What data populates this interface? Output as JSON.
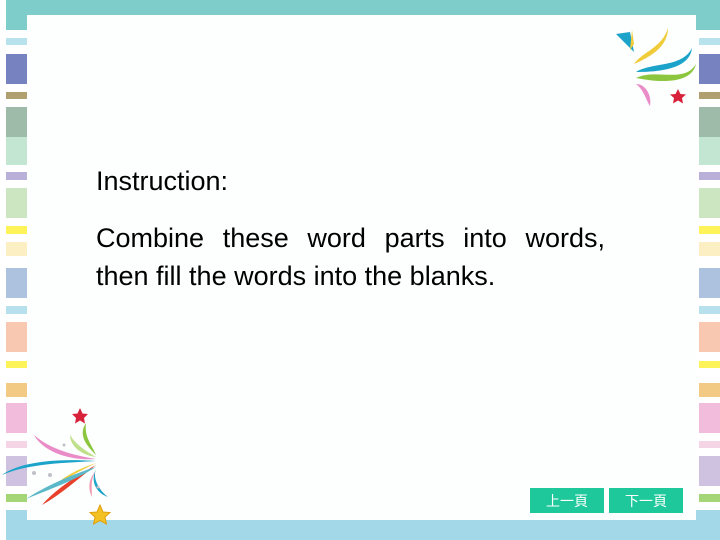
{
  "slide": {
    "instruction_title": "Instruction:",
    "instruction_body": "Combine these word parts into words, then fill the words into the blanks."
  },
  "navigation": {
    "prev_label": "上一頁",
    "next_label": "下一頁",
    "button_color": "#1ec89a"
  },
  "theme": {
    "top_bar_color": "#7ecdcb",
    "bottom_bar_color": "#a3d8e8",
    "stripe_colors": [
      "#b9e3ec",
      "#7783c0",
      "#b0a070",
      "#9dbba8",
      "#c2e6d2",
      "#b8b0d8",
      "#cbe6c0",
      "#fff35a",
      "#fbefc3",
      "#adc2de",
      "#b6e0ec",
      "#f8c8b0",
      "#fff35a",
      "#f2ca84",
      "#f2bcdc",
      "#f5d4e6",
      "#cfc2e0",
      "#a4d678"
    ]
  },
  "decorations": {
    "top_right": "ribbon-burst-with-red-star",
    "bottom_left": "ribbon-burst-with-red-star-and-gold-star"
  }
}
